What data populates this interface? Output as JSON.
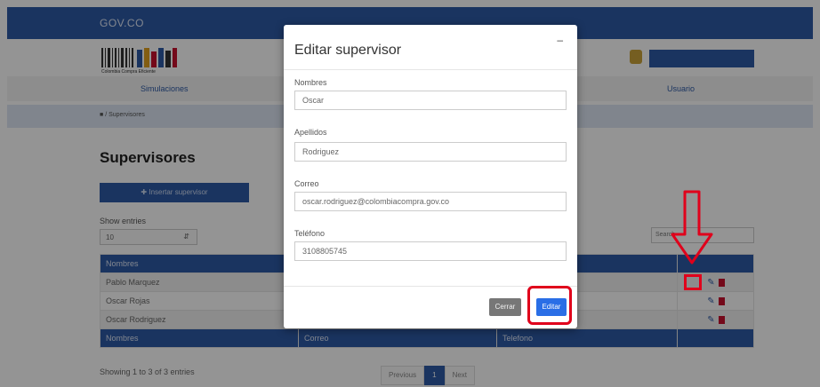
{
  "header": {
    "gov_logo": "GOV.CO",
    "brand_caption": "Colombia Compra Eficiente"
  },
  "nav": {
    "items": [
      "Simulaciones",
      "Usuario"
    ]
  },
  "breadcrumb": "/ Supervisores",
  "page": {
    "title": "Supervisores",
    "insert_button": "Insertar supervisor",
    "show_entries_label": "Show entries",
    "entries_value": "10",
    "search_placeholder": "Search"
  },
  "table": {
    "columns": [
      "Nombres",
      "Correo",
      "Telefono"
    ],
    "rows": [
      {
        "nombre": "Pablo Marquez"
      },
      {
        "nombre": "Oscar Rojas"
      },
      {
        "nombre": "Oscar Rodriguez"
      }
    ],
    "info": "Showing 1 to 3 of 3 entries",
    "pager": {
      "prev": "Previous",
      "page": "1",
      "next": "Next"
    }
  },
  "modal": {
    "title": "Editar supervisor",
    "close_glyph": "–",
    "fields": [
      {
        "label": "Nombres",
        "value": "Oscar"
      },
      {
        "label": "Apellidos",
        "value": "Rodriguez"
      },
      {
        "label": "Correo",
        "value": "oscar.rodriguez@colombiacompra.gov.co"
      },
      {
        "label": "Teléfono",
        "value": "3108805745"
      }
    ],
    "cerrar_label": "Cerrar",
    "editar_label": "Editar"
  },
  "icons": {
    "edit": "edit-icon",
    "delete": "trash-icon",
    "emblem": "coat-of-arms-icon",
    "plus": "plus-circle-icon",
    "home": "home-icon",
    "annotation": "red-arrow-down"
  },
  "colors": {
    "primary": "#2e5aa6",
    "danger": "#c8102e",
    "highlight": "#e0001b",
    "edit_button": "#2a6ee6"
  }
}
